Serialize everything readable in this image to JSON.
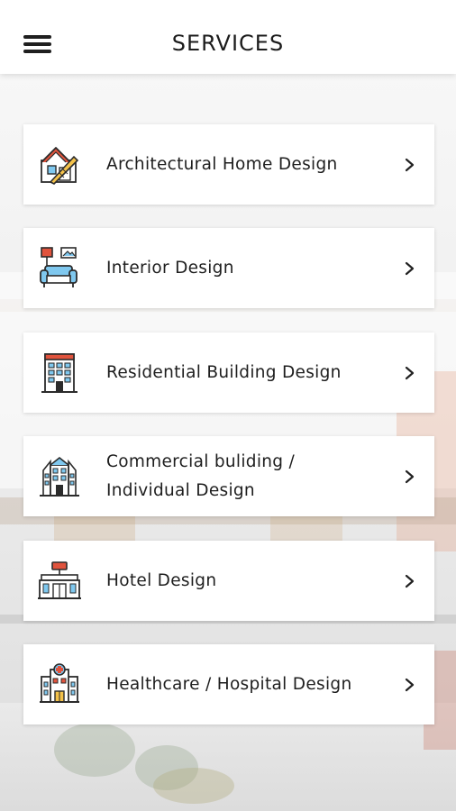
{
  "header": {
    "title": "SERVICES",
    "menu_icon": "hamburger-menu-icon"
  },
  "services": [
    {
      "label": "Architectural Home Design",
      "icon": "house-blueprint-icon"
    },
    {
      "label": "Interior Design",
      "icon": "sofa-lamp-frame-icon"
    },
    {
      "label": "Residential Building Design",
      "icon": "residential-building-icon"
    },
    {
      "label": "Commercial buliding / Individual Design",
      "icon": "commercial-building-icon"
    },
    {
      "label": "Hotel Design",
      "icon": "hotel-icon"
    },
    {
      "label": "Healthcare / Hospital Design",
      "icon": "hospital-icon"
    }
  ],
  "colors": {
    "header_bg": "#ffffff",
    "card_bg": "#ffffff",
    "text": "#1e1e1e",
    "icon_accent_yellow": "#f4c24a",
    "icon_accent_red": "#e0533d",
    "icon_accent_blue": "#7fc8ef",
    "icon_outline": "#2b2b2b"
  }
}
